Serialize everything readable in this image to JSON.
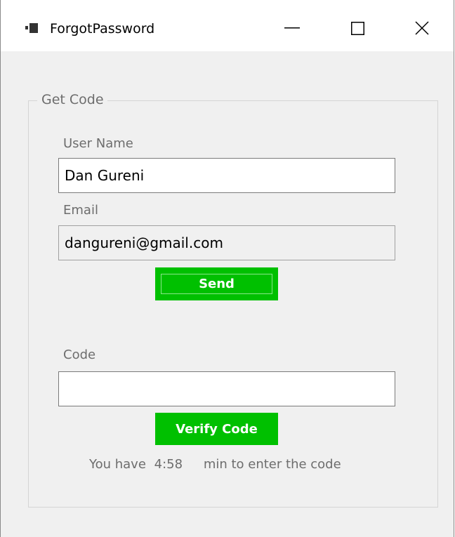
{
  "window": {
    "title": "ForgotPassword"
  },
  "group": {
    "label": "Get Code"
  },
  "username": {
    "label": "User Name",
    "value": "Dan Gureni"
  },
  "email": {
    "label": "Email",
    "value": "dangureni@gmail.com"
  },
  "send_button": {
    "label": "Send"
  },
  "code": {
    "label": "Code",
    "value": ""
  },
  "verify_button": {
    "label": "Verify Code"
  },
  "timer": {
    "prefix": "You have",
    "value": "4:58",
    "suffix": "min to enter the code"
  },
  "colors": {
    "button_green": "#00c000",
    "button_text": "#ffffff",
    "window_bg": "#f0f0f0",
    "label_gray": "#6d6d6d"
  },
  "icons": {
    "app": "app-icon",
    "minimize": "minimize-icon",
    "maximize": "maximize-icon",
    "close": "close-icon"
  }
}
